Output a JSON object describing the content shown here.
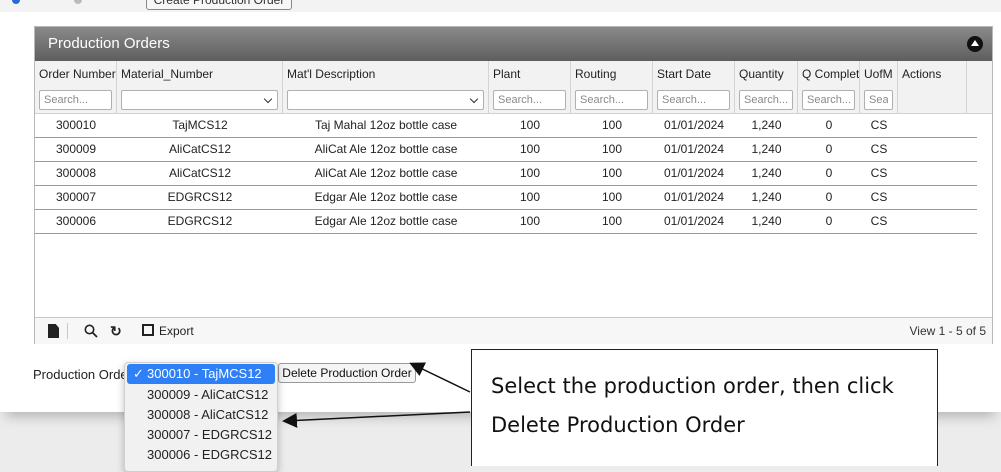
{
  "top": {
    "button_label": "Create Production Order"
  },
  "grid": {
    "caption": "Production Orders",
    "columns": [
      "Order Number",
      "Material_Number",
      "Mat'l Description",
      "Plant",
      "Routing",
      "Start Date",
      "Quantity",
      "Q Complete",
      "UofM",
      "Actions"
    ],
    "search_placeholder": "Search...",
    "search_placeholder_short": "Sea",
    "rows": [
      {
        "order": "300010",
        "material": "TajMCS12",
        "desc": "Taj Mahal 12oz bottle case",
        "plant": "100",
        "routing": "100",
        "start": "01/01/2024",
        "qty": "1,240",
        "qcomp": "0",
        "uofm": "CS"
      },
      {
        "order": "300009",
        "material": "AliCatCS12",
        "desc": "AliCat Ale 12oz bottle case",
        "plant": "100",
        "routing": "100",
        "start": "01/01/2024",
        "qty": "1,240",
        "qcomp": "0",
        "uofm": "CS"
      },
      {
        "order": "300008",
        "material": "AliCatCS12",
        "desc": "AliCat Ale 12oz bottle case",
        "plant": "100",
        "routing": "100",
        "start": "01/01/2024",
        "qty": "1,240",
        "qcomp": "0",
        "uofm": "CS"
      },
      {
        "order": "300007",
        "material": "EDGRCS12",
        "desc": "Edgar Ale 12oz bottle case",
        "plant": "100",
        "routing": "100",
        "start": "01/01/2024",
        "qty": "1,240",
        "qcomp": "0",
        "uofm": "CS"
      },
      {
        "order": "300006",
        "material": "EDGRCS12",
        "desc": "Edgar Ale 12oz bottle case",
        "plant": "100",
        "routing": "100",
        "start": "01/01/2024",
        "qty": "1,240",
        "qcomp": "0",
        "uofm": "CS"
      }
    ],
    "pager": {
      "export_label": "Export",
      "view_text": "View 1 - 5 of 5",
      "icons": [
        "new-file-icon",
        "search-icon",
        "refresh-icon",
        "export-icon"
      ]
    }
  },
  "production_order": {
    "label": "Production Order",
    "options": [
      "300010 - TajMCS12",
      "300009 - AliCatCS12",
      "300008 - AliCatCS12",
      "300007 - EDGRCS12",
      "300006 - EDGRCS12"
    ],
    "selected": "300010 - TajMCS12",
    "delete_label": "Delete Production Order"
  },
  "callout": {
    "text": "Select the production order, then click Delete Production Order"
  },
  "colors": {
    "caption_bg": "#6e6e6e",
    "selected_option": "#2f7ff6",
    "radio": "#2a6ad6"
  }
}
